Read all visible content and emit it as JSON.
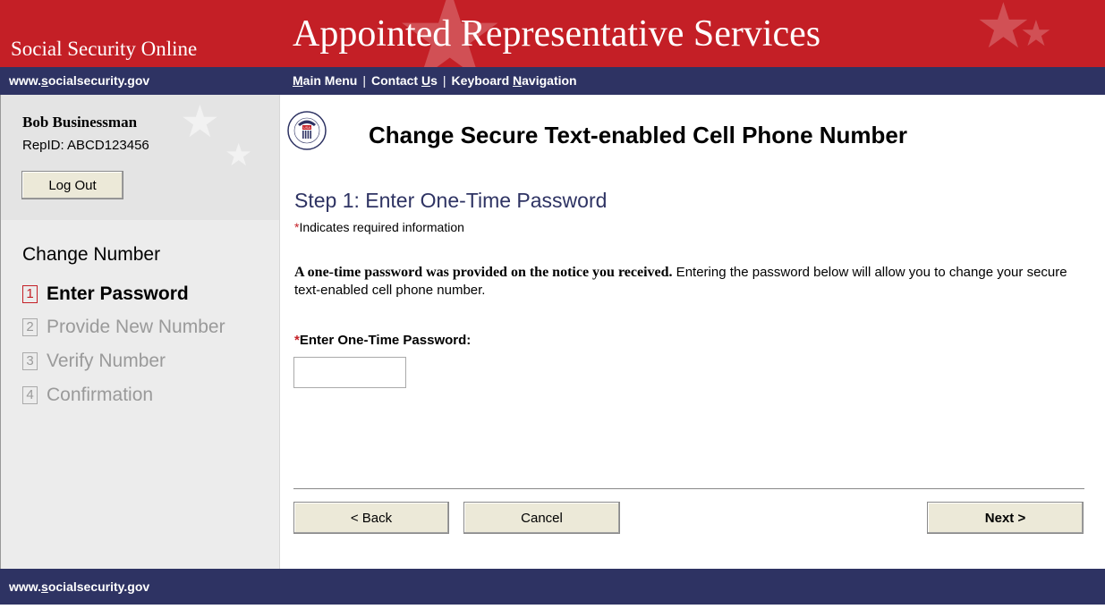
{
  "header": {
    "site_name": "Social Security Online",
    "app_title": "Appointed Representative Services"
  },
  "navbar": {
    "url_prefix": "www.",
    "url_accel": "s",
    "url_rest": "ocialsecurity.gov",
    "links": [
      {
        "pre": "",
        "accel": "M",
        "post": "ain Menu"
      },
      {
        "pre": "Contact ",
        "accel": "U",
        "post": "s"
      },
      {
        "pre": "Keyboard ",
        "accel": "N",
        "post": "avigation"
      }
    ],
    "separator": "|"
  },
  "sidebar": {
    "user_name": "Bob Businessman",
    "rep_id": "RepID:  ABCD123456",
    "logout_label": "Log Out",
    "steps_heading": "Change Number",
    "steps": [
      {
        "number": "1",
        "label": "Enter Password"
      },
      {
        "number": "2",
        "label": "Provide New Number"
      },
      {
        "number": "3",
        "label": "Verify Number"
      },
      {
        "number": "4",
        "label": "Confirmation"
      }
    ]
  },
  "main": {
    "seal_text": "SOCIAL SECURITY ADMINISTRATION",
    "seal_usa": "USA",
    "page_title": "Change Secure Text-enabled Cell Phone Number",
    "step_heading": "Step 1:  Enter One-Time Password",
    "required_marker": "*",
    "required_note": "Indicates required information",
    "instructions_bold": "A one-time password was provided on the notice you received.",
    "instructions_rest": "  Entering the password below will allow you to change your secure text-enabled cell phone number.",
    "password_label": "Enter One-Time Password:",
    "password_value": "",
    "buttons": {
      "back": "< Back",
      "cancel": "Cancel",
      "next": "Next >"
    }
  },
  "footer": {
    "url_prefix": "www.",
    "url_accel": "s",
    "url_rest": "ocialsecurity.gov"
  },
  "colors": {
    "header_red": "#c41f26",
    "nav_navy": "#2e3363",
    "sidebar_gray": "#ececec",
    "heading_blue": "#2e3363",
    "required_red": "#c41f26",
    "inactive_step": "#9a9a9a"
  }
}
